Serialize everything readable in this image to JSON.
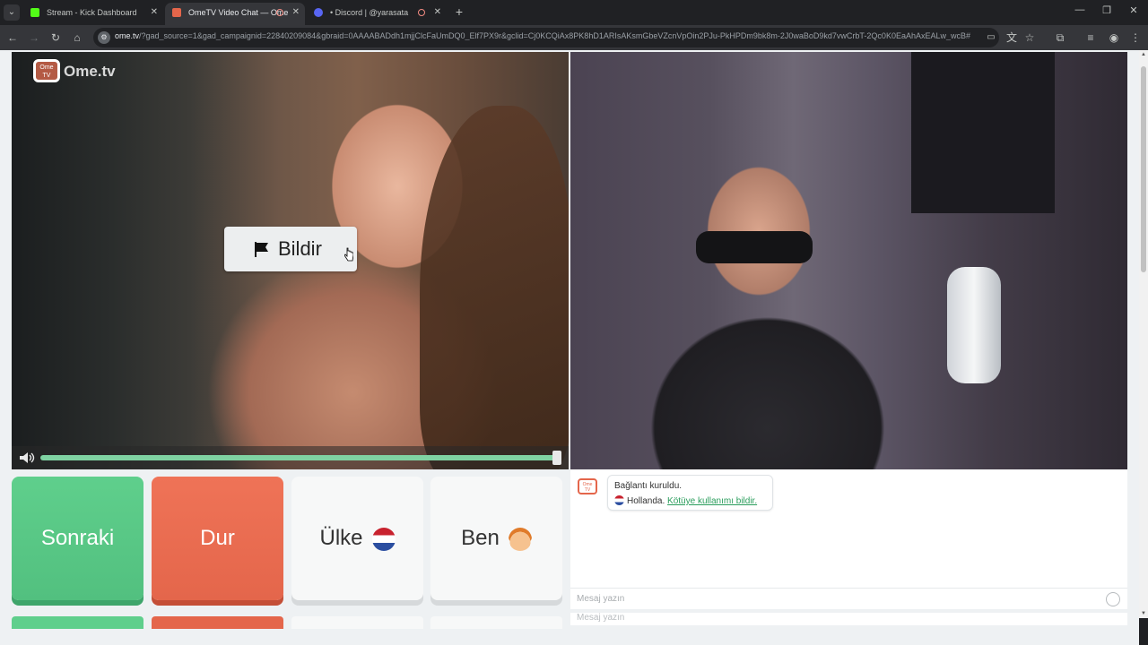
{
  "browser": {
    "tabs": [
      {
        "title": "Stream - Kick Dashboard",
        "favicon_color": "#53fc18"
      },
      {
        "title": "OmeTV Video Chat — Ome",
        "favicon_color": "#e4664b"
      },
      {
        "title": "• Discord | @yarasata",
        "favicon_color": "#5865f2"
      }
    ],
    "new_tab": "+",
    "url_host": "ome.tv",
    "url_rest": "/?gad_source=1&gad_campaignid=22840209084&gbraid=0AAAABADdh1mjjClcFaUmDQ0_Elf7PX9r&gclid=Cj0KCQiAx8PK8hD1ARIsAKsmGbeVZcnVpOin2PJu-PkHPDm9bk8m-2J0waBoD9kd7vwCrbT-2Qc0K0EaAhAxEALw_wcB#"
  },
  "logo": {
    "badge": "Ome TV",
    "text": "Ome.tv"
  },
  "report_button": {
    "label": "Bildir"
  },
  "buttons": {
    "next": "Sonraki",
    "stop": "Dur",
    "country": "Ülke",
    "me": "Ben"
  },
  "volume": {
    "level": 1.0
  },
  "chat": {
    "line1": "Bağlantı kuruldu.",
    "country": "Hollanda.",
    "report_link": "Kötüye kullanımı bildir."
  },
  "input": {
    "placeholder": "Mesaj yazın"
  },
  "colors": {
    "next": "#5fcf8c",
    "stop": "#e4664b",
    "link": "#2a9d5c"
  }
}
